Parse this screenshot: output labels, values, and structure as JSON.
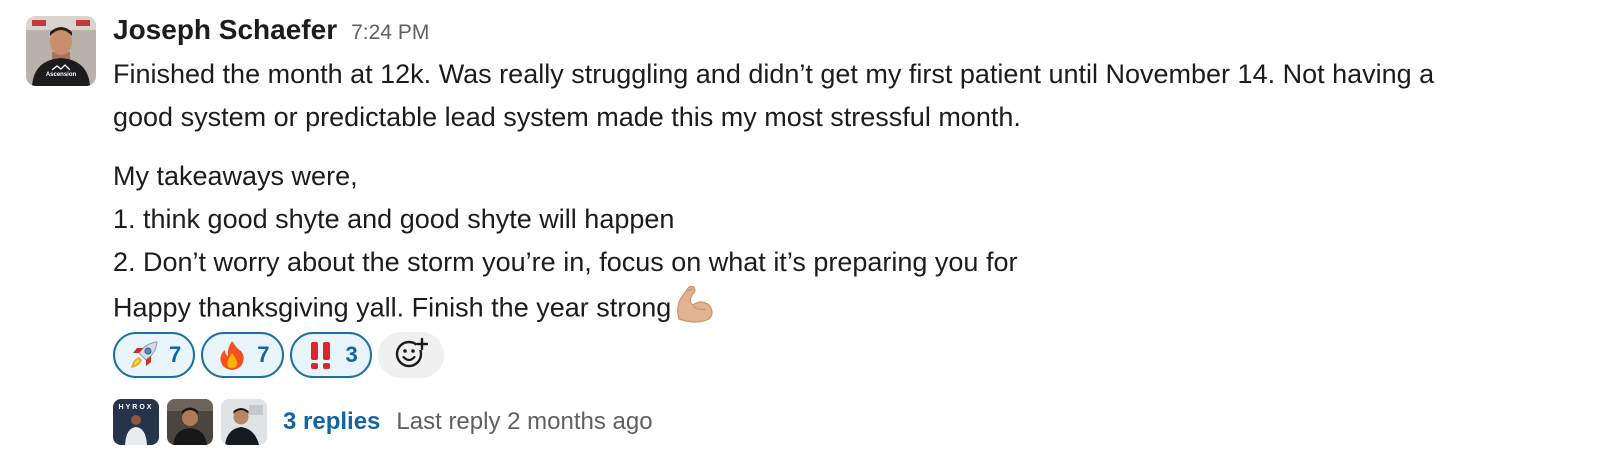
{
  "message": {
    "sender": "Joseph Schaefer",
    "timestamp": "7:24 PM",
    "avatar_shirt_text": "Ascension",
    "paragraph1": [
      "Finished the month at 12k. Was really struggling and didn’t get my first patient until November 14.  Not having a",
      "good system or predictable lead system made this my most stressful month."
    ],
    "paragraph2": [
      "My takeaways were,",
      "1. think good shyte and good shyte will happen",
      "2. Don’t worry about the storm you’re in, focus on what it’s preparing you for",
      "Happy thanksgiving yall. Finish the year strong"
    ],
    "trailing_emoji": "flexed-biceps-icon"
  },
  "reactions": [
    {
      "emoji": "rocket-icon",
      "count": "7"
    },
    {
      "emoji": "fire-icon",
      "count": "7"
    },
    {
      "emoji": "double-exclamation-icon",
      "count": "3"
    }
  ],
  "add_reaction_icon": "add-reaction-icon",
  "thread": {
    "avatars": [
      "replier-avatar-1",
      "replier-avatar-2",
      "replier-avatar-3"
    ],
    "first_avatar_text": "HYROX",
    "reply_count": "3 replies",
    "last_reply": "Last reply 2 months ago"
  },
  "colors": {
    "link": "#1264a3",
    "reaction_border": "#1d6fa5",
    "reaction_bg": "#e8f5fa",
    "muted": "#616061"
  }
}
